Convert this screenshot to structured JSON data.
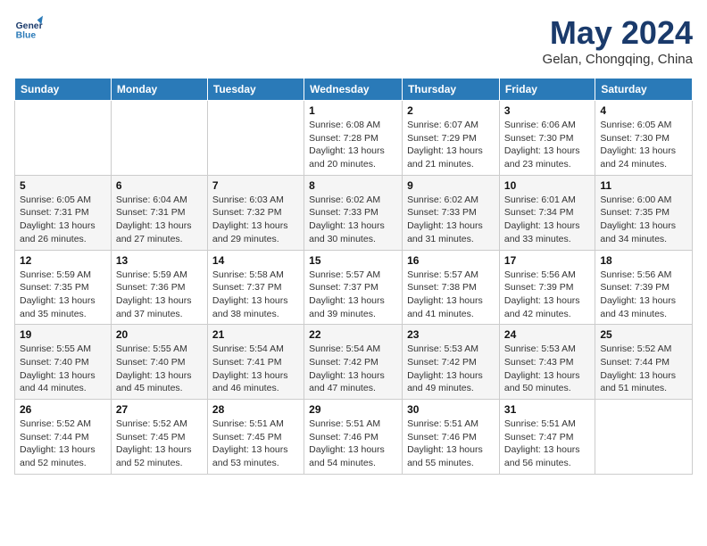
{
  "logo": {
    "line1": "General",
    "line2": "Blue"
  },
  "title": "May 2024",
  "location": "Gelan, Chongqing, China",
  "days_of_week": [
    "Sunday",
    "Monday",
    "Tuesday",
    "Wednesday",
    "Thursday",
    "Friday",
    "Saturday"
  ],
  "weeks": [
    [
      {
        "day": "",
        "info": ""
      },
      {
        "day": "",
        "info": ""
      },
      {
        "day": "",
        "info": ""
      },
      {
        "day": "1",
        "info": "Sunrise: 6:08 AM\nSunset: 7:28 PM\nDaylight: 13 hours and 20 minutes."
      },
      {
        "day": "2",
        "info": "Sunrise: 6:07 AM\nSunset: 7:29 PM\nDaylight: 13 hours and 21 minutes."
      },
      {
        "day": "3",
        "info": "Sunrise: 6:06 AM\nSunset: 7:30 PM\nDaylight: 13 hours and 23 minutes."
      },
      {
        "day": "4",
        "info": "Sunrise: 6:05 AM\nSunset: 7:30 PM\nDaylight: 13 hours and 24 minutes."
      }
    ],
    [
      {
        "day": "5",
        "info": "Sunrise: 6:05 AM\nSunset: 7:31 PM\nDaylight: 13 hours and 26 minutes."
      },
      {
        "day": "6",
        "info": "Sunrise: 6:04 AM\nSunset: 7:31 PM\nDaylight: 13 hours and 27 minutes."
      },
      {
        "day": "7",
        "info": "Sunrise: 6:03 AM\nSunset: 7:32 PM\nDaylight: 13 hours and 29 minutes."
      },
      {
        "day": "8",
        "info": "Sunrise: 6:02 AM\nSunset: 7:33 PM\nDaylight: 13 hours and 30 minutes."
      },
      {
        "day": "9",
        "info": "Sunrise: 6:02 AM\nSunset: 7:33 PM\nDaylight: 13 hours and 31 minutes."
      },
      {
        "day": "10",
        "info": "Sunrise: 6:01 AM\nSunset: 7:34 PM\nDaylight: 13 hours and 33 minutes."
      },
      {
        "day": "11",
        "info": "Sunrise: 6:00 AM\nSunset: 7:35 PM\nDaylight: 13 hours and 34 minutes."
      }
    ],
    [
      {
        "day": "12",
        "info": "Sunrise: 5:59 AM\nSunset: 7:35 PM\nDaylight: 13 hours and 35 minutes."
      },
      {
        "day": "13",
        "info": "Sunrise: 5:59 AM\nSunset: 7:36 PM\nDaylight: 13 hours and 37 minutes."
      },
      {
        "day": "14",
        "info": "Sunrise: 5:58 AM\nSunset: 7:37 PM\nDaylight: 13 hours and 38 minutes."
      },
      {
        "day": "15",
        "info": "Sunrise: 5:57 AM\nSunset: 7:37 PM\nDaylight: 13 hours and 39 minutes."
      },
      {
        "day": "16",
        "info": "Sunrise: 5:57 AM\nSunset: 7:38 PM\nDaylight: 13 hours and 41 minutes."
      },
      {
        "day": "17",
        "info": "Sunrise: 5:56 AM\nSunset: 7:39 PM\nDaylight: 13 hours and 42 minutes."
      },
      {
        "day": "18",
        "info": "Sunrise: 5:56 AM\nSunset: 7:39 PM\nDaylight: 13 hours and 43 minutes."
      }
    ],
    [
      {
        "day": "19",
        "info": "Sunrise: 5:55 AM\nSunset: 7:40 PM\nDaylight: 13 hours and 44 minutes."
      },
      {
        "day": "20",
        "info": "Sunrise: 5:55 AM\nSunset: 7:40 PM\nDaylight: 13 hours and 45 minutes."
      },
      {
        "day": "21",
        "info": "Sunrise: 5:54 AM\nSunset: 7:41 PM\nDaylight: 13 hours and 46 minutes."
      },
      {
        "day": "22",
        "info": "Sunrise: 5:54 AM\nSunset: 7:42 PM\nDaylight: 13 hours and 47 minutes."
      },
      {
        "day": "23",
        "info": "Sunrise: 5:53 AM\nSunset: 7:42 PM\nDaylight: 13 hours and 49 minutes."
      },
      {
        "day": "24",
        "info": "Sunrise: 5:53 AM\nSunset: 7:43 PM\nDaylight: 13 hours and 50 minutes."
      },
      {
        "day": "25",
        "info": "Sunrise: 5:52 AM\nSunset: 7:44 PM\nDaylight: 13 hours and 51 minutes."
      }
    ],
    [
      {
        "day": "26",
        "info": "Sunrise: 5:52 AM\nSunset: 7:44 PM\nDaylight: 13 hours and 52 minutes."
      },
      {
        "day": "27",
        "info": "Sunrise: 5:52 AM\nSunset: 7:45 PM\nDaylight: 13 hours and 52 minutes."
      },
      {
        "day": "28",
        "info": "Sunrise: 5:51 AM\nSunset: 7:45 PM\nDaylight: 13 hours and 53 minutes."
      },
      {
        "day": "29",
        "info": "Sunrise: 5:51 AM\nSunset: 7:46 PM\nDaylight: 13 hours and 54 minutes."
      },
      {
        "day": "30",
        "info": "Sunrise: 5:51 AM\nSunset: 7:46 PM\nDaylight: 13 hours and 55 minutes."
      },
      {
        "day": "31",
        "info": "Sunrise: 5:51 AM\nSunset: 7:47 PM\nDaylight: 13 hours and 56 minutes."
      },
      {
        "day": "",
        "info": ""
      }
    ]
  ]
}
